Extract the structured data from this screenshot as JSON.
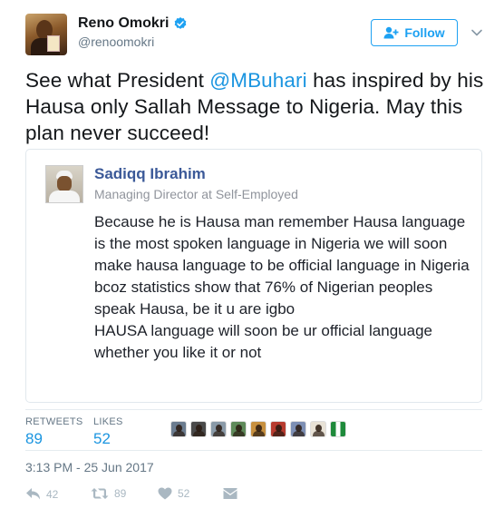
{
  "author": {
    "display_name": "Reno Omokri",
    "handle": "@renoomokri",
    "verified": true
  },
  "follow_button": {
    "label": "Follow"
  },
  "tweet": {
    "text_before": "See what President ",
    "mention": "@MBuhari",
    "text_after": " has inspired by his Hausa only Sallah Message to Nigeria. May this plan never succeed!"
  },
  "embedded_post": {
    "author_name": "Sadiqq Ibrahim",
    "author_subtitle": "Managing Director at Self-Employed",
    "paragraph_1": "Because he is Hausa man remember Hausa language is the most spoken language in Nigeria we will soon make hausa language to be official language in Nigeria bcoz statistics show that 76% of Nigerian peoples speak Hausa, be it u are igbo",
    "paragraph_2": "HAUSA language will soon be ur official language whether you like it or not"
  },
  "stats": {
    "retweets_label": "RETWEETS",
    "retweets_value": "89",
    "likes_label": "LIKES",
    "likes_value": "52"
  },
  "likers": [
    {
      "icon": "avatar",
      "color": "#6b7c8f"
    },
    {
      "icon": "avatar",
      "color": "#4a4a4a"
    },
    {
      "icon": "avatar",
      "color": "#8a9aa8"
    },
    {
      "icon": "avatar",
      "color": "#5f8a5a"
    },
    {
      "icon": "avatar",
      "color": "#c7903f"
    },
    {
      "icon": "avatar",
      "color": "#b73b2f"
    },
    {
      "icon": "avatar",
      "color": "#7d8fb4"
    },
    {
      "icon": "avatar",
      "color": "#e8e2d6"
    },
    {
      "icon": "nigeria-flag-avatar",
      "color": "#1f8a3b"
    }
  ],
  "timestamp": "3:13 PM - 25 Jun 2017",
  "actions": {
    "reply_count": "42",
    "retweet_count": "89",
    "like_count": "52"
  },
  "colors": {
    "accent": "#1da1f2",
    "link": "#1b95e0",
    "facebook_name": "#3b5998",
    "muted": "#657786",
    "icon_muted": "#aab8c2"
  },
  "icons": {
    "verified": "verified-badge-icon",
    "follow": "add-user-icon",
    "caret": "chevron-down-icon",
    "reply": "reply-icon",
    "retweet": "retweet-icon",
    "like": "heart-icon",
    "message": "direct-message-icon"
  }
}
